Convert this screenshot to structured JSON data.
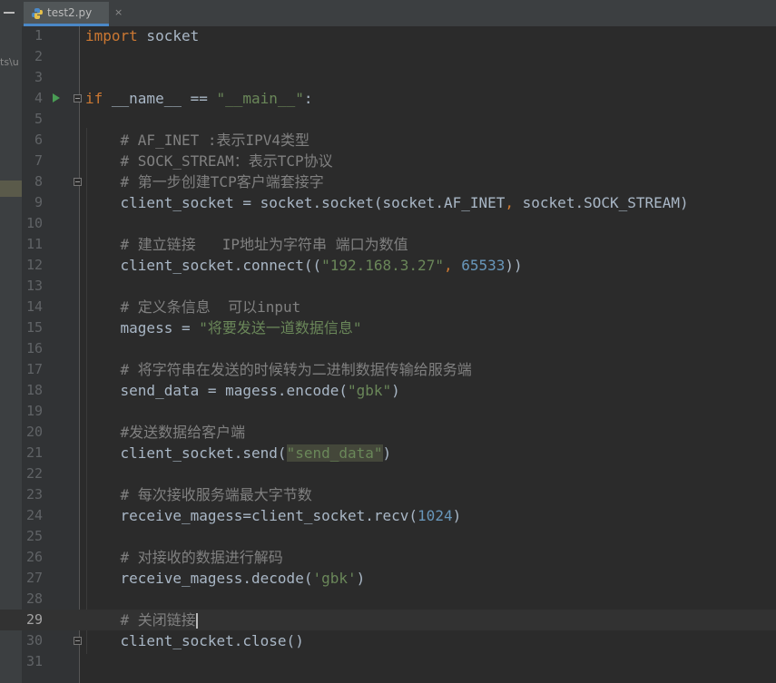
{
  "tab": {
    "label": "test2.py",
    "close": "×"
  },
  "sidebar": {
    "path_fragment": "ts\\u"
  },
  "lines": [
    {
      "num": "1",
      "tokens": [
        {
          "t": "import",
          "c": "kw"
        },
        {
          "t": " socket",
          "c": ""
        }
      ]
    },
    {
      "num": "2",
      "tokens": []
    },
    {
      "num": "3",
      "tokens": []
    },
    {
      "num": "4",
      "tokens": [
        {
          "t": "if",
          "c": "kw"
        },
        {
          "t": " __name__ == ",
          "c": ""
        },
        {
          "t": "\"__main__\"",
          "c": "str"
        },
        {
          "t": ":",
          "c": ""
        }
      ]
    },
    {
      "num": "5",
      "tokens": []
    },
    {
      "num": "6",
      "tokens": [
        {
          "t": "    # AF_INET :表示IPV4类型",
          "c": "cmt"
        }
      ]
    },
    {
      "num": "7",
      "tokens": [
        {
          "t": "    # SOCK_STREAM：表示TCP协议",
          "c": "cmt"
        }
      ]
    },
    {
      "num": "8",
      "tokens": [
        {
          "t": "    # 第一步创建TCP客户端套接字",
          "c": "cmt"
        }
      ]
    },
    {
      "num": "9",
      "tokens": [
        {
          "t": "    client_socket = socket.socket(socket.AF_INET",
          "c": ""
        },
        {
          "t": ",",
          "c": "kw"
        },
        {
          "t": " socket.SOCK_STREAM)",
          "c": ""
        }
      ]
    },
    {
      "num": "10",
      "tokens": []
    },
    {
      "num": "11",
      "tokens": [
        {
          "t": "    # 建立链接   IP地址为字符串 端口为数值",
          "c": "cmt"
        }
      ]
    },
    {
      "num": "12",
      "tokens": [
        {
          "t": "    client_socket.connect((",
          "c": ""
        },
        {
          "t": "\"192.168.3.27\"",
          "c": "str"
        },
        {
          "t": ",",
          "c": "kw"
        },
        {
          "t": " ",
          "c": ""
        },
        {
          "t": "65533",
          "c": "num"
        },
        {
          "t": "))",
          "c": ""
        }
      ]
    },
    {
      "num": "13",
      "tokens": []
    },
    {
      "num": "14",
      "tokens": [
        {
          "t": "    # 定义条信息  可以input",
          "c": "cmt"
        }
      ]
    },
    {
      "num": "15",
      "tokens": [
        {
          "t": "    magess = ",
          "c": ""
        },
        {
          "t": "\"将要发送一道数据信息\"",
          "c": "str"
        }
      ]
    },
    {
      "num": "16",
      "tokens": []
    },
    {
      "num": "17",
      "tokens": [
        {
          "t": "    # 将字符串在发送的时候转为二进制数据传输给服务端",
          "c": "cmt"
        }
      ]
    },
    {
      "num": "18",
      "tokens": [
        {
          "t": "    send_data = magess.encode(",
          "c": ""
        },
        {
          "t": "\"gbk\"",
          "c": "str"
        },
        {
          "t": ")",
          "c": ""
        }
      ]
    },
    {
      "num": "19",
      "tokens": []
    },
    {
      "num": "20",
      "tokens": [
        {
          "t": "    #发送数据给客户端",
          "c": "cmt"
        }
      ]
    },
    {
      "num": "21",
      "tokens": [
        {
          "t": "    client_socket.send(",
          "c": ""
        },
        {
          "t": "\"send_data\"",
          "c": "str hl"
        },
        {
          "t": ")",
          "c": ""
        }
      ]
    },
    {
      "num": "22",
      "tokens": []
    },
    {
      "num": "23",
      "tokens": [
        {
          "t": "    # 每次接收服务端最大字节数",
          "c": "cmt"
        }
      ]
    },
    {
      "num": "24",
      "tokens": [
        {
          "t": "    receive_magess=client_socket.recv(",
          "c": ""
        },
        {
          "t": "1024",
          "c": "num"
        },
        {
          "t": ")",
          "c": ""
        }
      ]
    },
    {
      "num": "25",
      "tokens": []
    },
    {
      "num": "26",
      "tokens": [
        {
          "t": "    # 对接收的数据进行解码",
          "c": "cmt"
        }
      ]
    },
    {
      "num": "27",
      "tokens": [
        {
          "t": "    receive_magess.decode(",
          "c": ""
        },
        {
          "t": "'gbk'",
          "c": "str"
        },
        {
          "t": ")",
          "c": ""
        }
      ]
    },
    {
      "num": "28",
      "tokens": []
    },
    {
      "num": "29",
      "tokens": [
        {
          "t": "    # 关闭链接",
          "c": "cmt"
        }
      ],
      "current": true
    },
    {
      "num": "30",
      "tokens": [
        {
          "t": "    client_socket.close()",
          "c": ""
        }
      ]
    },
    {
      "num": "31",
      "tokens": []
    }
  ],
  "run_line": 4,
  "fold_lines": [
    4,
    8,
    30
  ]
}
